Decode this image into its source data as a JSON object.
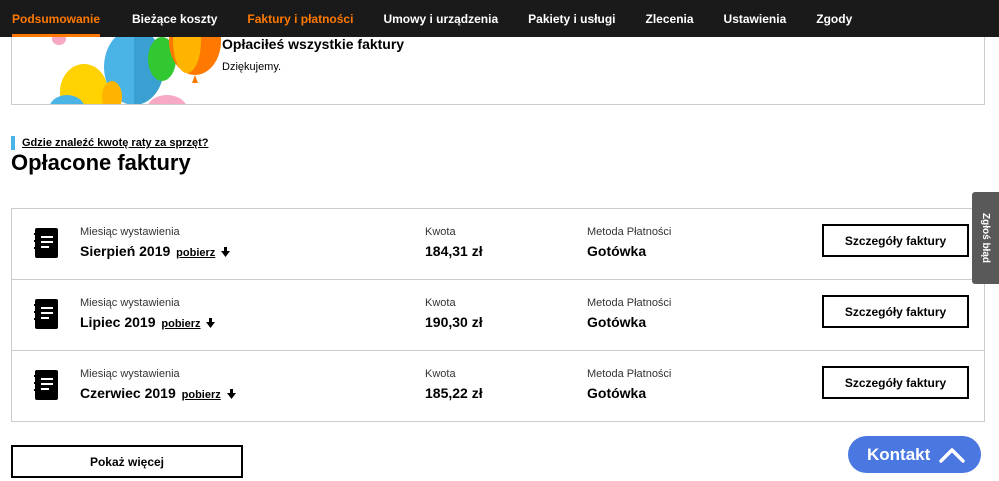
{
  "nav": {
    "items": [
      {
        "label": "Podsumowanie"
      },
      {
        "label": "Bieżące koszty"
      },
      {
        "label": "Faktury i płatności"
      },
      {
        "label": "Umowy i urządzenia"
      },
      {
        "label": "Pakiety i usługi"
      },
      {
        "label": "Zlecenia"
      },
      {
        "label": "Ustawienia"
      },
      {
        "label": "Zgody"
      }
    ]
  },
  "banner": {
    "title": "Opłaciłeś wszystkie faktury",
    "subtitle": "Dziękujemy."
  },
  "help_link": "Gdzie znaleźć kwotę raty za sprzęt?",
  "section_title": "Opłacone faktury",
  "invoices": {
    "month_label": "Miesiąc wystawienia",
    "amount_label": "Kwota",
    "method_label": "Metoda Płatności",
    "download_label": "pobierz",
    "details_label": "Szczegóły faktury",
    "rows": [
      {
        "month": "Sierpień 2019",
        "amount": "184,31 zł",
        "method": "Gotówka"
      },
      {
        "month": "Lipiec 2019",
        "amount": "190,30 zł",
        "method": "Gotówka"
      },
      {
        "month": "Czerwiec 2019",
        "amount": "185,22 zł",
        "method": "Gotówka"
      }
    ]
  },
  "show_more": "Pokaż więcej",
  "report_tab": "Zgłoś błąd",
  "contact": "Kontakt",
  "colors": {
    "accent": "#ff7900",
    "nav_bg": "#1a1a1a",
    "contact_bg": "#4a78e0",
    "help_bar": "#4bb4e6"
  }
}
